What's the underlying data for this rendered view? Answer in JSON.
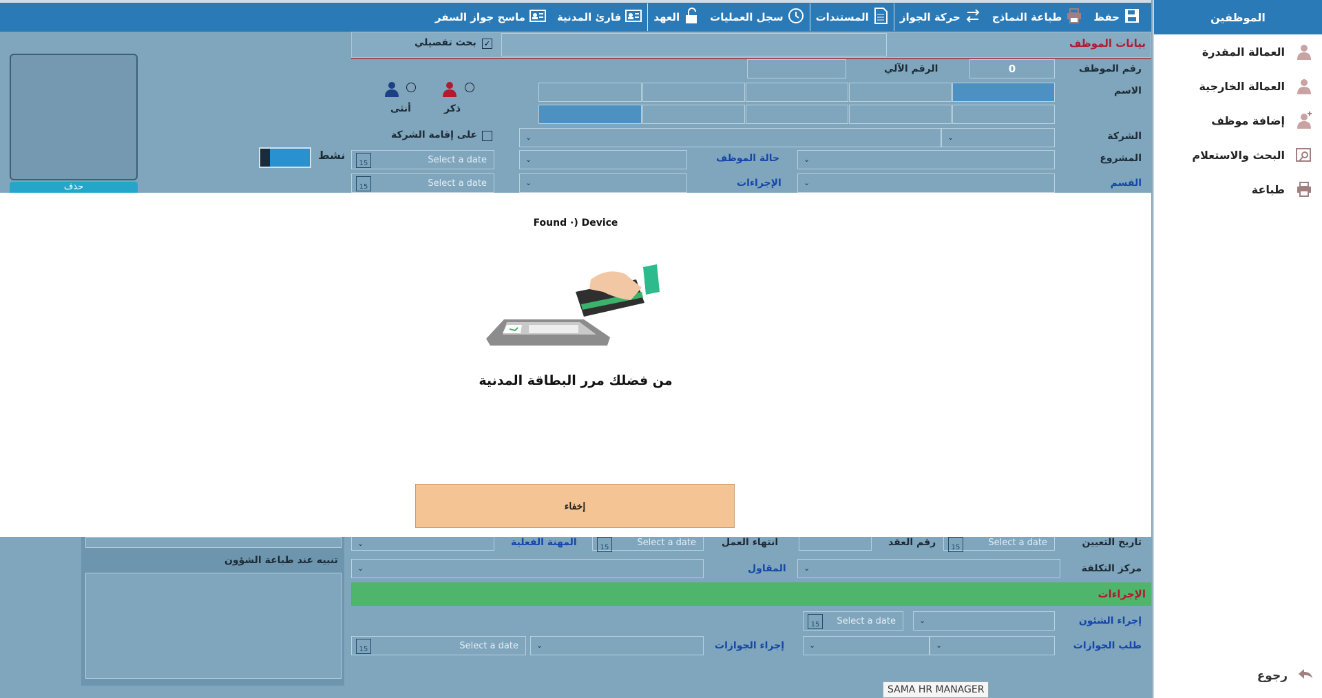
{
  "sidebar": {
    "header": "الموظفين",
    "items": [
      {
        "label": "العمالة المقدرة",
        "icon": "person-icon"
      },
      {
        "label": "العمالة الخارجية",
        "icon": "person-icon"
      },
      {
        "label": "إضافة موظف",
        "icon": "add-person-icon"
      },
      {
        "label": "البحث والاستعلام",
        "icon": "search-person-icon"
      },
      {
        "label": "طباعة",
        "icon": "printer-icon"
      }
    ],
    "back_label": "رجوع"
  },
  "toolbar": {
    "items": [
      {
        "label": "حفظ",
        "icon": "save-icon"
      },
      {
        "label": "طباعة النماذج",
        "icon": "printer-icon"
      },
      {
        "label": "حركة الجواز",
        "icon": "transfer-arrows-icon"
      },
      {
        "label": "المستندات",
        "icon": "document-icon"
      },
      {
        "label": "سجل العمليات",
        "icon": "clock-icon"
      },
      {
        "label": "العهد",
        "icon": "unlock-icon"
      },
      {
        "label": "قارئ المدنية",
        "icon": "id-card-icon"
      },
      {
        "label": "ماسح جواز السفر",
        "icon": "id-card-icon"
      }
    ]
  },
  "form": {
    "section_title": "بيانات الموظف",
    "advanced_search": "بحث تفصيلي",
    "employee_no_label": "رقم الموظف",
    "employee_no_value": "0",
    "auto_no_label": "الرقم الآلي",
    "name_label": "الاسم",
    "male_label": "ذكر",
    "female_label": "أنثى",
    "company_label": "الشركة",
    "company_residence_label": "على إقامة الشركة",
    "project_label": "المشروع",
    "employee_status_label": "حالة الموظف",
    "active_label": "نشط",
    "department_label": "القسم",
    "procedures_label": "الإجراءات",
    "date_placeholder": "Select a date",
    "cal_day": "15",
    "delete_label": "حذف",
    "appointment_date_label": "تاريخ التعيين",
    "contract_no_label": "رقم العقد",
    "work_end_label": "انتهاء العمل",
    "actual_profession_label": "المهنة الفعلية",
    "cost_center_label": "مركز التكلفة",
    "contractor_label": "المقاول",
    "alert_print_label": "تنبيه عند طباعة الشؤون",
    "procedures_section": "الإجراءات",
    "affairs_procedure_label": "إجراء الشئون",
    "passports_request_label": "طلب الجوازات",
    "passports_procedure_label": "إجراء الجوازات"
  },
  "modal": {
    "title": "Found ·) Device",
    "instruction": "من فضلك مرر البطاقة المدنية",
    "hide_button": "إخفاء"
  },
  "footer": {
    "app_name": "SAMA HR MANAGER"
  },
  "colors": {
    "toolbar": "#2a7ab8",
    "form_bg": "#7fa6bd",
    "button": "#f5c495",
    "green_bar": "#4fb56c"
  }
}
